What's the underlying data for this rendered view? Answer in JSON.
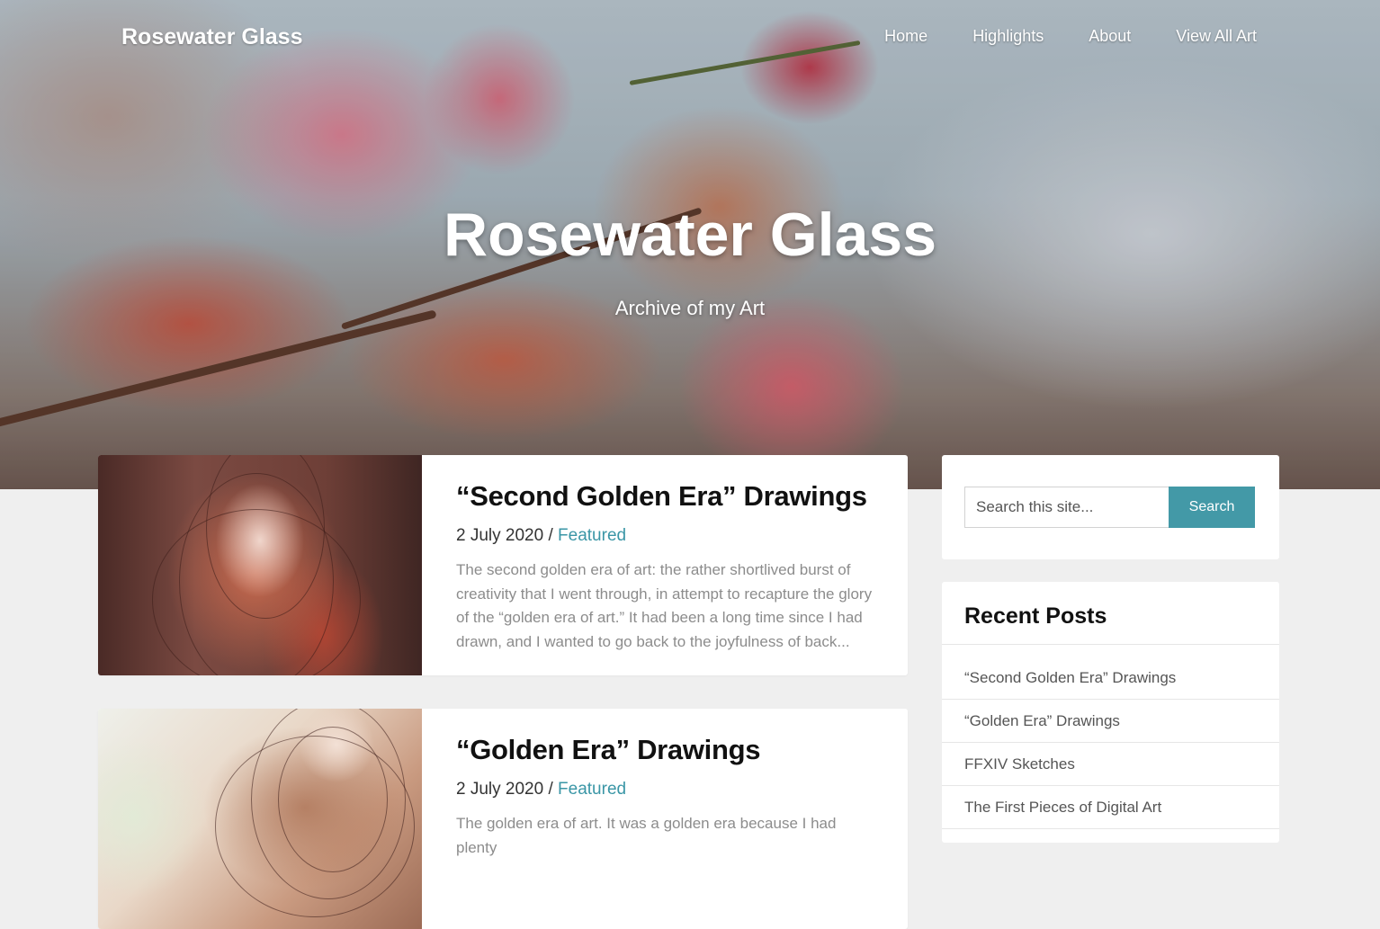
{
  "site": {
    "title": "Rosewater Glass"
  },
  "nav": {
    "items": [
      "Home",
      "Highlights",
      "About",
      "View All Art"
    ]
  },
  "hero": {
    "title": "Rosewater Glass",
    "subtitle": "Archive of my Art"
  },
  "posts": [
    {
      "title": "“Second Golden Era” Drawings",
      "date": "2 July 2020",
      "separator": " / ",
      "category": "Featured",
      "excerpt": "The second golden era of art: the rather shortlived burst of creativity that I went through, in attempt to recapture the glory of the “golden era of art.” It had been a long time since I had drawn, and I wanted to go back to the joyfulness of back..."
    },
    {
      "title": "“Golden Era” Drawings",
      "date": "2 July 2020",
      "separator": " / ",
      "category": "Featured",
      "excerpt": "The golden era of art. It was a golden era because I had plenty"
    }
  ],
  "search": {
    "placeholder": "Search this site...",
    "button_label": "Search"
  },
  "recent_posts": {
    "title": "Recent Posts",
    "items": [
      "“Second Golden Era” Drawings",
      "“Golden Era” Drawings",
      "FFXIV Sketches",
      "The First Pieces of Digital Art"
    ]
  },
  "colors": {
    "accent": "#4399a7",
    "link": "#3a96a6",
    "page_background": "#efefef"
  }
}
